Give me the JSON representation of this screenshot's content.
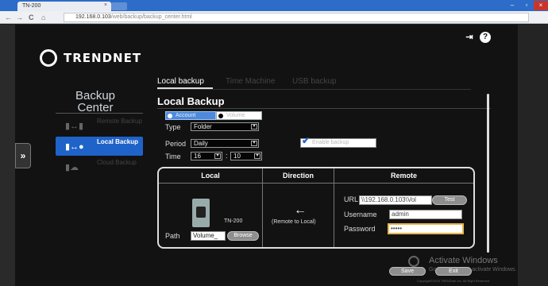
{
  "browser": {
    "tab_title": "TN-200",
    "tab_close": "×",
    "url_host": "192.168.0.103",
    "url_path": "/web/backup/backup_center.html",
    "back": "←",
    "forward": "→",
    "reload": "C",
    "home": "⌂",
    "win_min": "–",
    "win_max": "▫",
    "win_close": "×"
  },
  "brand": {
    "name": "TRENDNET"
  },
  "header_icons": {
    "logout": "⇥",
    "help": "?"
  },
  "sidebar": {
    "title": "Backup Center",
    "items": [
      {
        "label": "Remote Backup",
        "icon": "remote-backup-icon",
        "active": false
      },
      {
        "label": "Local Backup",
        "icon": "local-backup-icon",
        "active": true
      },
      {
        "label": "Cloud Backup",
        "icon": "cloud-backup-icon",
        "active": false
      }
    ]
  },
  "expander": "»",
  "tabs": [
    {
      "label": "Local backup",
      "active": true
    },
    {
      "label": "Time Machine",
      "active": false
    },
    {
      "label": "USB backup",
      "active": false
    }
  ],
  "section": {
    "heading": "Local Backup"
  },
  "mode": {
    "option1": "Account",
    "option2": "Volume"
  },
  "form": {
    "type_label": "Type",
    "type_value": "Folder",
    "period_label": "Period",
    "period_value": "Daily",
    "time_label": "Time",
    "hour": "16",
    "minute": "10",
    "colon": ":",
    "enable_checked": true,
    "enable_label": "Enable backup"
  },
  "panel": {
    "local_header": "Local",
    "direction_header": "Direction",
    "remote_header": "Remote",
    "device_name": "TN-200",
    "path_label": "Path",
    "path_value": "Volume_",
    "browse": "Browse",
    "direction_arrow": "←",
    "direction_label": "(Remote to Local)",
    "url_label": "URL",
    "url_value": "\\\\192.168.0.103\\Vol",
    "test": "Test",
    "username_label": "Username",
    "username_value": "admin",
    "password_label": "Password",
    "password_value": "•••••"
  },
  "footer": {
    "save": "Save",
    "exit": "Exit",
    "watermark_title": "Activate Windows",
    "watermark_sub": "Go to Settings to activate Windows.",
    "copyright": "Copyright©2015 TRENDnet Inc. All Right Reserved"
  }
}
